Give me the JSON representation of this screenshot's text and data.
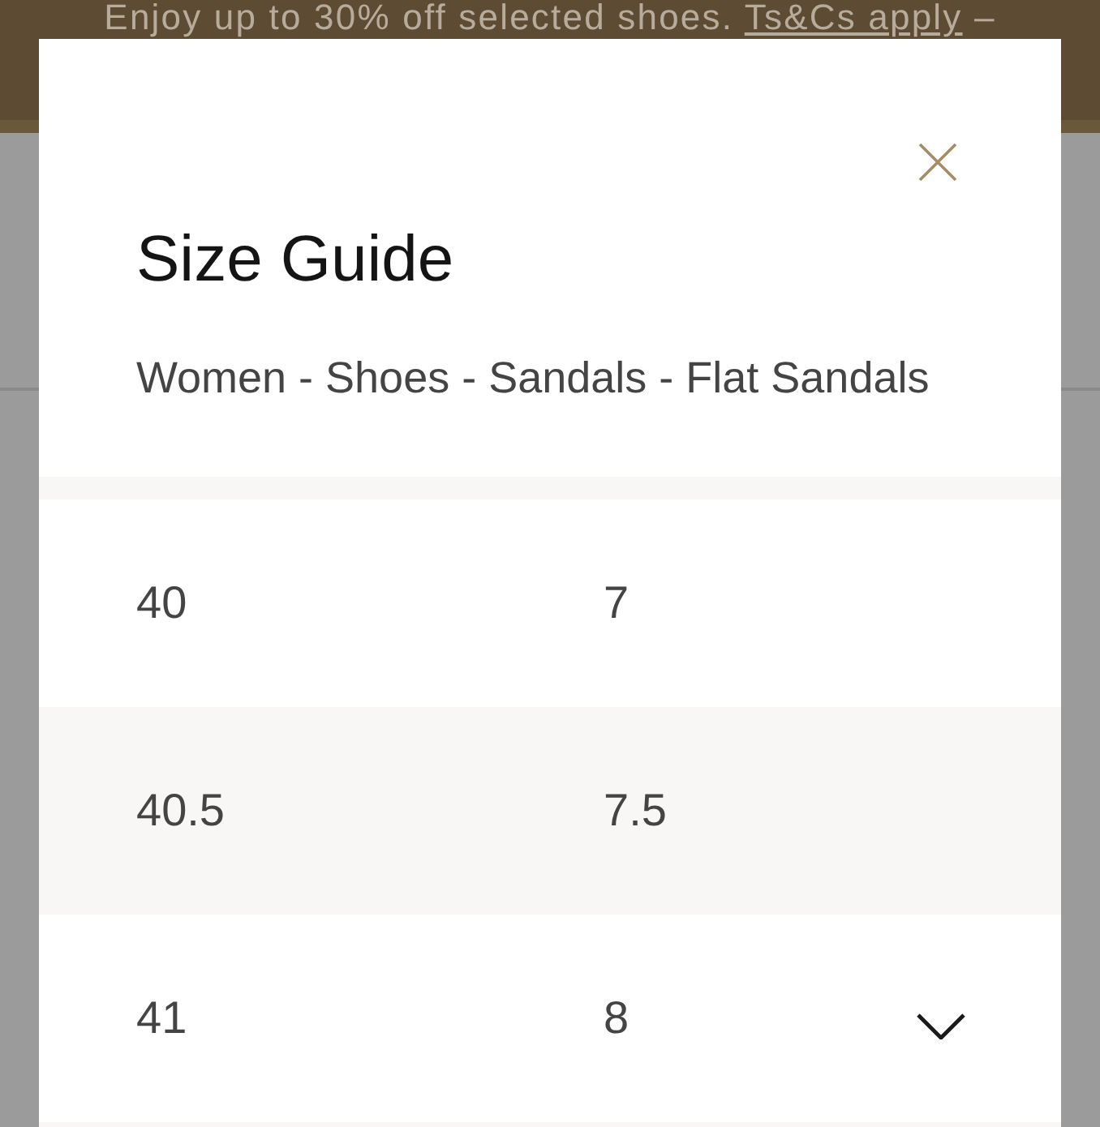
{
  "promo_banner": {
    "text": "Enjoy up to 30% off selected shoes.",
    "link": "Ts&Cs apply",
    "suffix": "–"
  },
  "size_guide": {
    "title": "Size Guide",
    "breadcrumb": "Women - Shoes - Sandals - Flat Sandals",
    "rows": [
      {
        "cells": [
          "40",
          "7"
        ]
      },
      {
        "cells": [
          "40.5",
          "7.5"
        ]
      },
      {
        "cells": [
          "41",
          "8"
        ]
      }
    ]
  }
}
